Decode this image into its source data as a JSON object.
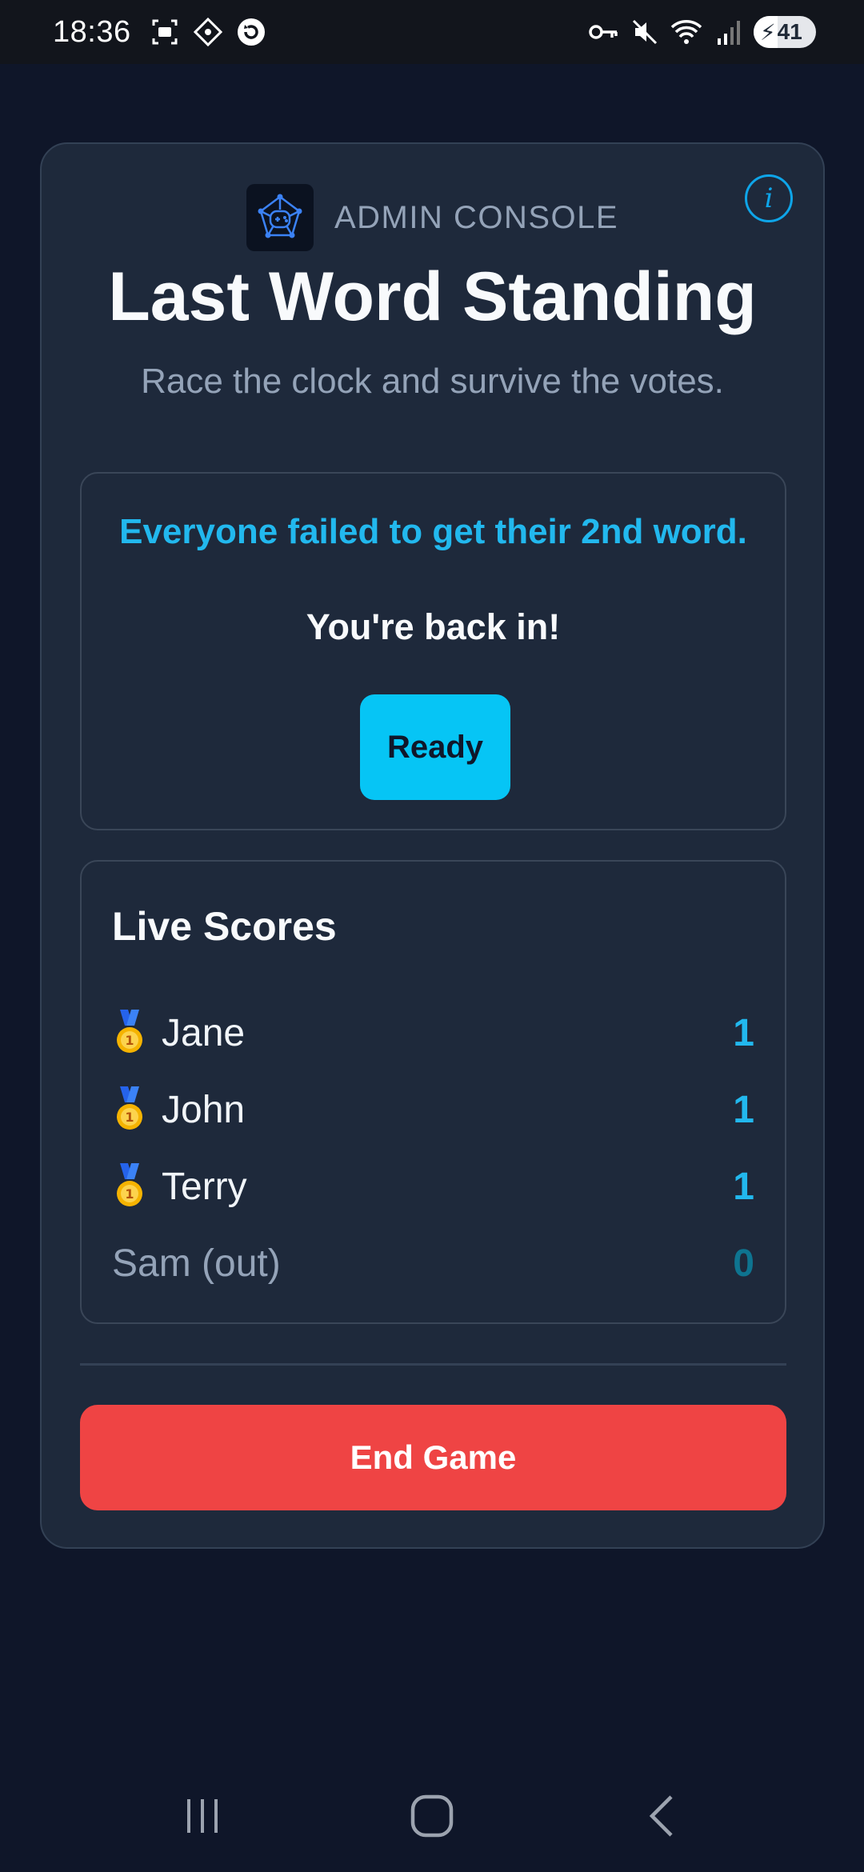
{
  "status_bar": {
    "time": "18:36",
    "battery": "41",
    "icons": [
      "screenshot-icon",
      "diamond-app-icon",
      "sync-icon",
      "vpn-key-icon",
      "mute-icon",
      "wifi-icon",
      "signal-icon",
      "battery-icon"
    ]
  },
  "header": {
    "brand_label": "ADMIN CONSOLE",
    "title": "Last Word Standing",
    "subtitle": "Race the clock and survive the votes.",
    "info_label": "i"
  },
  "message": {
    "headline": "Everyone failed to get their 2nd word.",
    "sub": "You're back in!",
    "ready_label": "Ready"
  },
  "scores": {
    "title": "Live Scores",
    "rows": [
      {
        "name": "Jane",
        "score": "1",
        "medal": true
      },
      {
        "name": "John",
        "score": "1",
        "medal": true
      },
      {
        "name": "Terry",
        "score": "1",
        "medal": true
      },
      {
        "name": "Sam (out)",
        "score": "0",
        "medal": false
      }
    ]
  },
  "actions": {
    "end_game_label": "End Game"
  },
  "colors": {
    "background": "#0f1629",
    "card": "#1e293b",
    "accent": "#22b8ee",
    "ready": "#06c5f5",
    "danger": "#ef4444"
  }
}
